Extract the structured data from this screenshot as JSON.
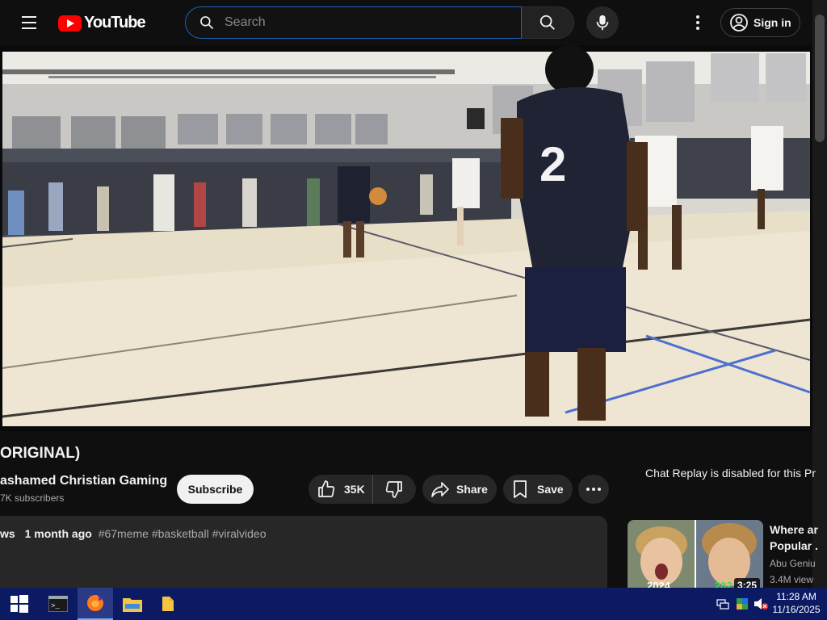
{
  "header": {
    "logo_text": "YouTube",
    "search_placeholder": "Search",
    "signin_label": "Sign in"
  },
  "video": {
    "title": "ORIGINAL)",
    "jersey_number": "2",
    "channel_name": "ashamed Christian Gaming",
    "subscribers": "7K subscribers",
    "subscribe_label": "Subscribe",
    "like_count": "35K",
    "share_label": "Share",
    "save_label": "Save",
    "views_fragment": "ws",
    "upload_age": "1 month ago",
    "hashtags": "#67meme #basketball #viralvideo"
  },
  "sidebar": {
    "chat_replay_notice": "Chat Replay is disabled for this Pr",
    "recommendation": {
      "title_line1": "Where ar",
      "title_line2": "Popular .",
      "channel": "Abu Geniu",
      "views": "3.4M view",
      "thumb_label_left": "2024",
      "thumb_label_right": "202",
      "duration": "3:25"
    }
  },
  "taskbar": {
    "time": "11:28 AM",
    "date": "11/16/2025",
    "items": [
      "windows-start-icon",
      "terminal-icon",
      "firefox-icon",
      "file-explorer-icon",
      "folder-icon"
    ]
  },
  "colors": {
    "background": "#0f0f0f",
    "youtube_red": "#ff0000",
    "search_focus": "#1c62b9",
    "pill_bg": "#272727",
    "taskbar": "#0b1a63"
  }
}
